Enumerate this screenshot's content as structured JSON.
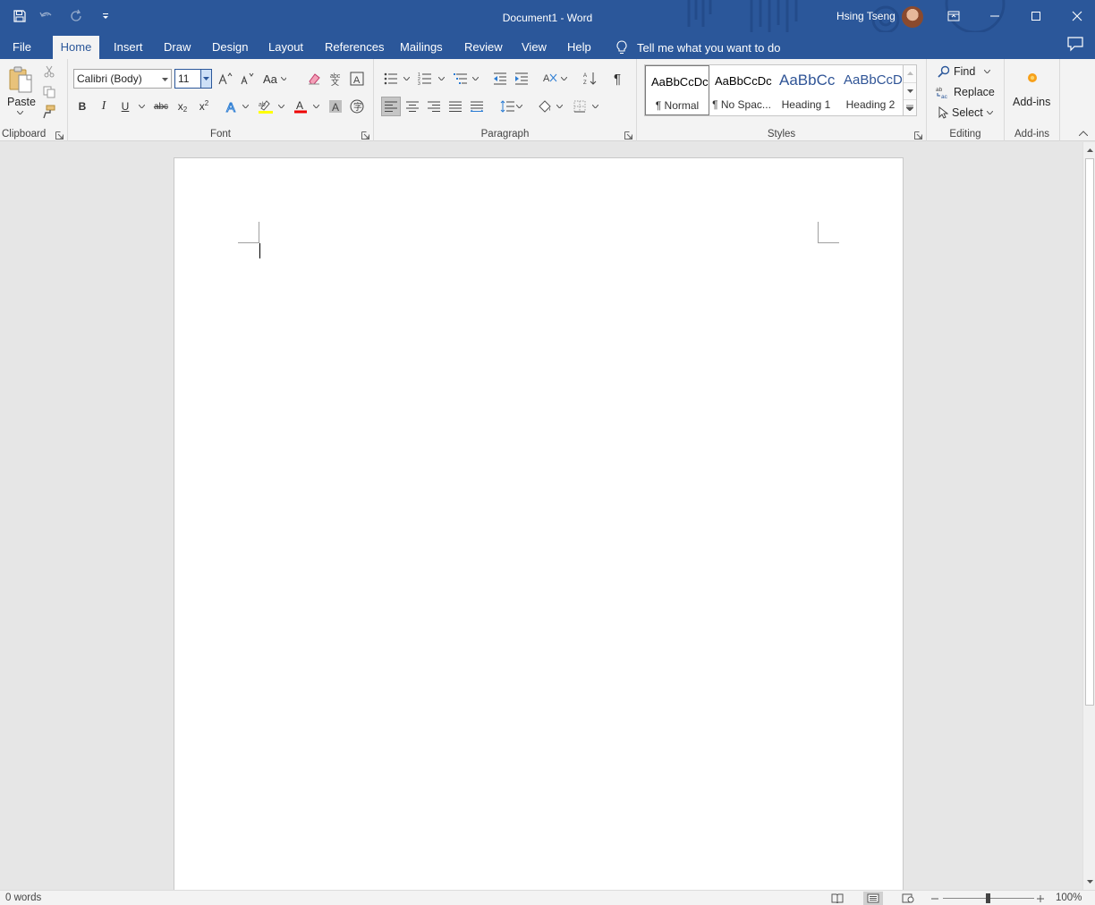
{
  "titlebar": {
    "doc_title": "Document1  -  Word",
    "user_name": "Hsing Tseng"
  },
  "tabs": [
    "File",
    "Home",
    "Insert",
    "Draw",
    "Design",
    "Layout",
    "References",
    "Mailings",
    "Review",
    "View",
    "Help"
  ],
  "active_tab": "Home",
  "tellme": {
    "placeholder": "Tell me what you want to do"
  },
  "ribbon": {
    "clipboard": {
      "label": "Clipboard",
      "paste_label": "Paste"
    },
    "font": {
      "label": "Font",
      "font_name": "Calibri (Body)",
      "font_size": "11"
    },
    "paragraph": {
      "label": "Paragraph"
    },
    "styles": {
      "label": "Styles",
      "items": [
        {
          "sample": "AaBbCcDc",
          "name": "¶ Normal",
          "selected": true
        },
        {
          "sample": "AaBbCcDc",
          "name": "¶ No Spac..."
        },
        {
          "sample": "AaBbCc",
          "name": "Heading 1"
        },
        {
          "sample": "AaBbCcD",
          "name": "Heading 2"
        }
      ]
    },
    "editing": {
      "label": "Editing",
      "find": "Find",
      "replace": "Replace",
      "select": "Select"
    },
    "addins": {
      "label": "Add-ins",
      "button": "Add-ins"
    }
  },
  "statusbar": {
    "word_count": "0 words",
    "zoom": "100%"
  },
  "colors": {
    "accent": "#2b579a",
    "ribbon_bg": "#f3f3f3",
    "canvas_bg": "#e6e6e6"
  }
}
